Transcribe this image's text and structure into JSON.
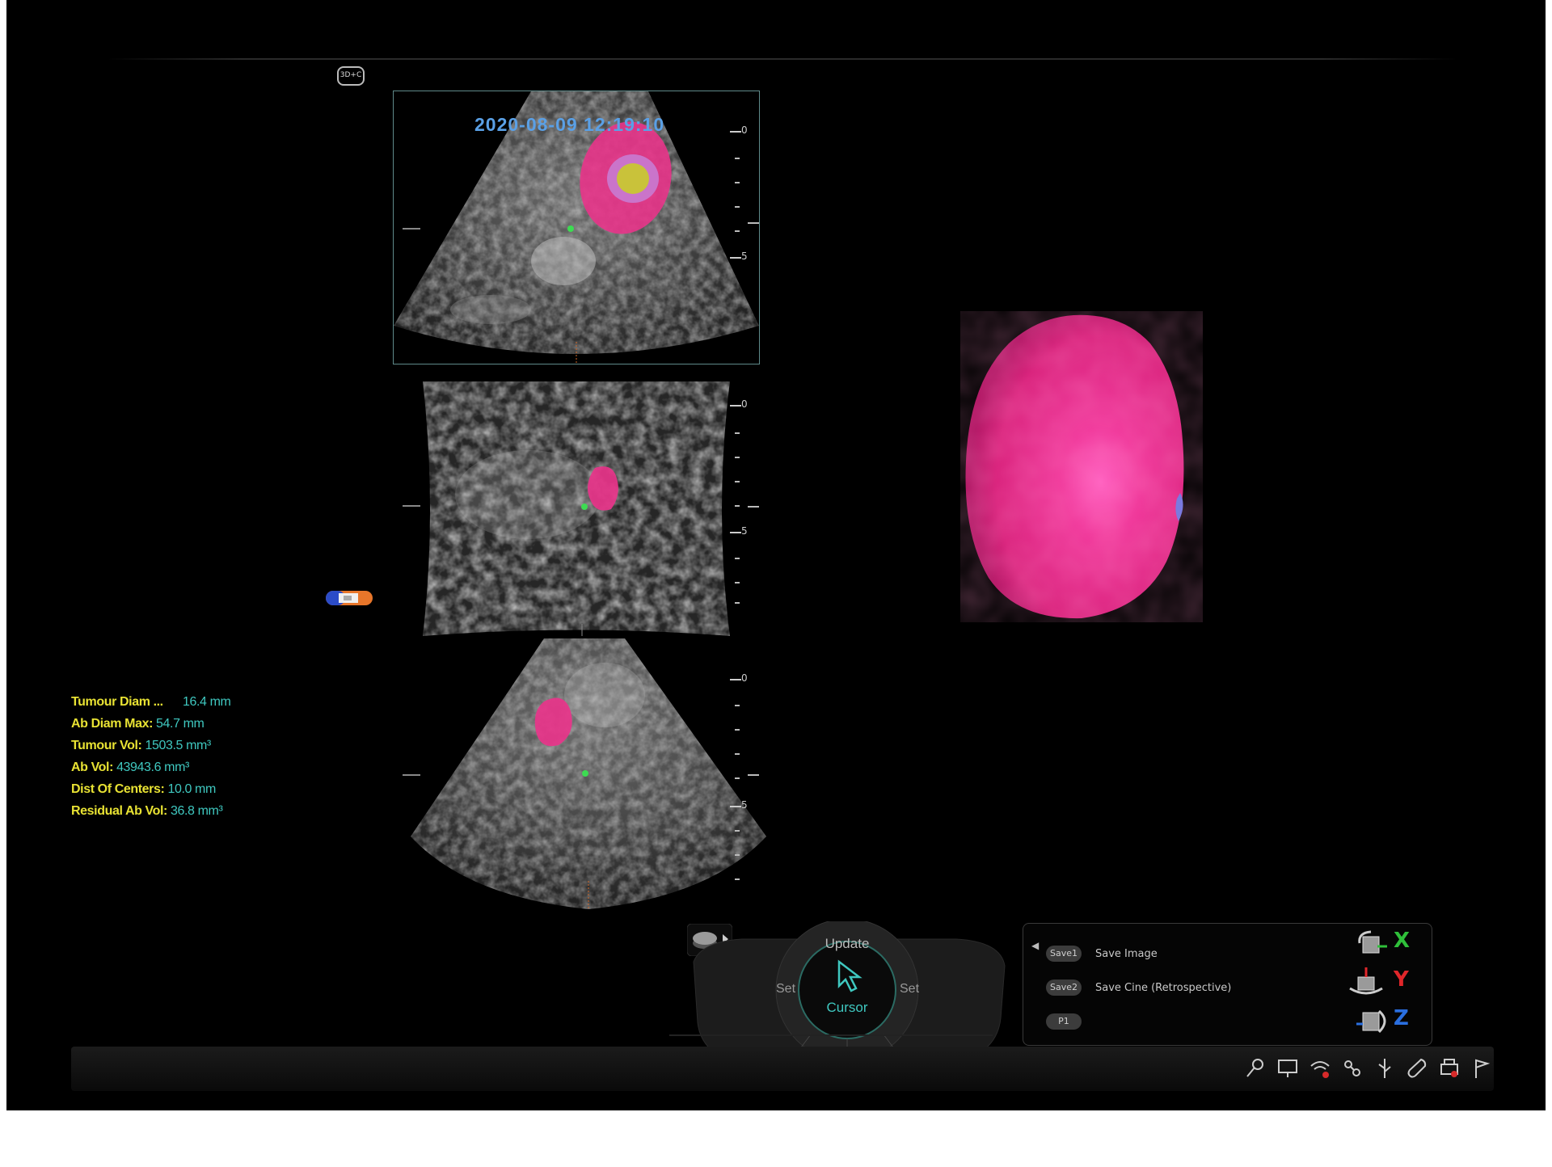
{
  "header": {
    "orientation_badge": "3D+C"
  },
  "viewer": {
    "timestamp": "2020-08-09 12:19:10",
    "ruler_labels": [
      "0",
      "5"
    ]
  },
  "measurements": [
    {
      "label": "Tumour Diam ...",
      "value": "16.4 mm"
    },
    {
      "label": "Ab Diam Max:",
      "value": "54.7 mm"
    },
    {
      "label": "Tumour Vol:",
      "value": "1503.5 mm³"
    },
    {
      "label": "Ab Vol:",
      "value": "43943.6 mm³"
    },
    {
      "label": "Dist Of Centers:",
      "value": "10.0 mm"
    },
    {
      "label": "Residual Ab Vol:",
      "value": "36.8 mm³"
    }
  ],
  "console": {
    "top_label": "Update",
    "left_label": "Set",
    "right_label": "Set",
    "center_label": "Cursor"
  },
  "save_panel": {
    "rows": [
      {
        "key": "Save1",
        "label": "Save Image"
      },
      {
        "key": "Save2",
        "label": "Save Cine (Retrospective)"
      },
      {
        "key": "P1",
        "label": ""
      }
    ]
  },
  "axes": {
    "x": {
      "label": "X",
      "color": "#2fbf3a"
    },
    "y": {
      "label": "Y",
      "color": "#e0262a"
    },
    "z": {
      "label": "Z",
      "color": "#2a6fe0"
    }
  },
  "colors": {
    "segmentation": "#e8348a",
    "blob_3d": "#e8287f",
    "measure_label": "#e8e233",
    "measure_value": "#3fc8c0",
    "timestamp": "#5aa0e6"
  },
  "status_icons": [
    "key-icon",
    "monitor-icon",
    "wifi-off-icon",
    "network-icon",
    "usb-icon",
    "wrench-icon",
    "printer-icon",
    "flag-icon"
  ]
}
